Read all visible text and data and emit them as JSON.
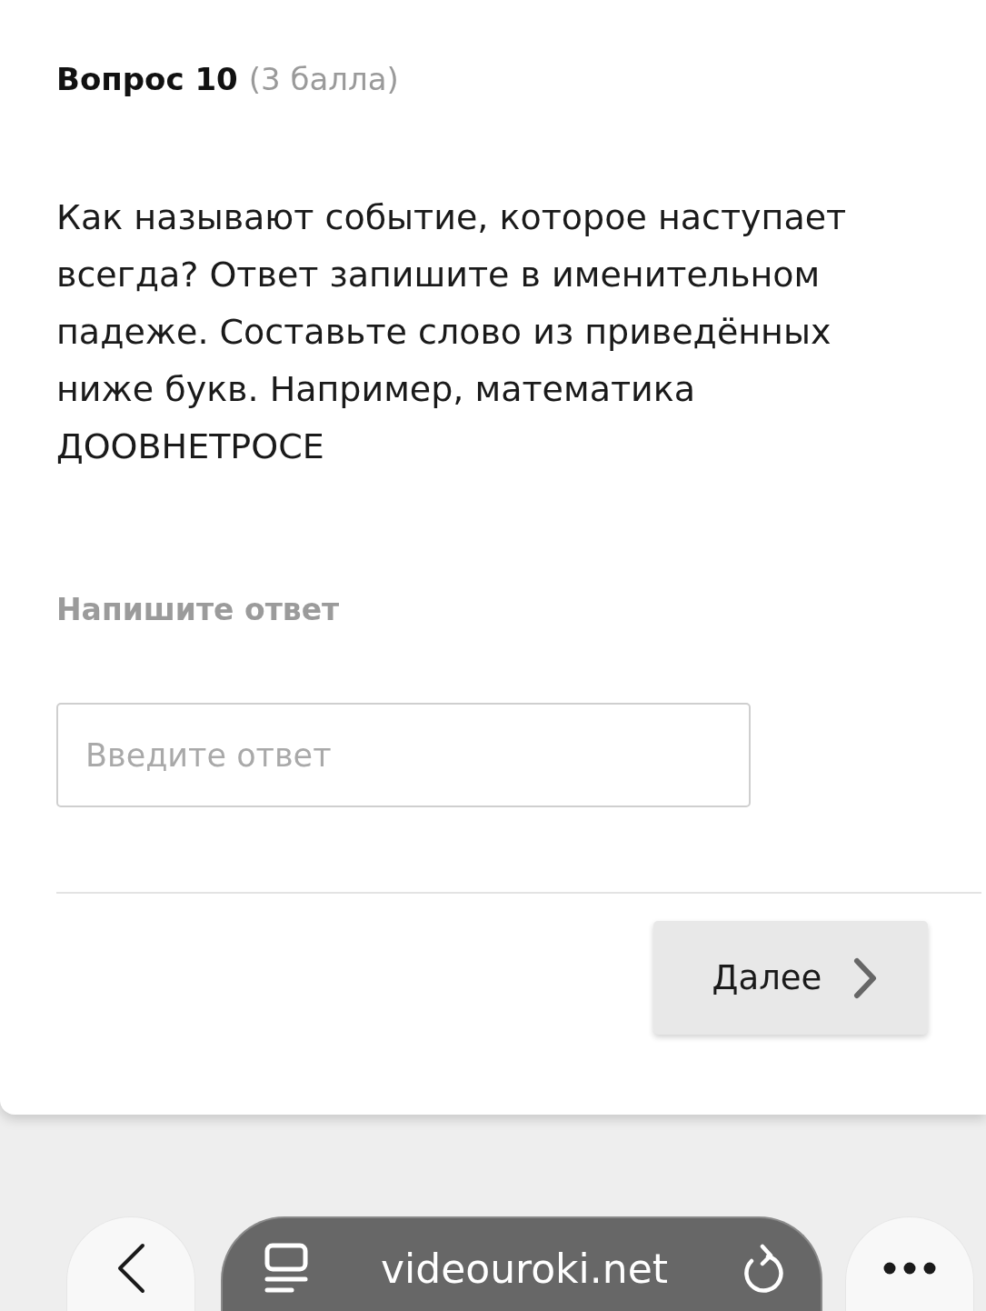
{
  "question": {
    "title": "Вопрос 10",
    "points": "(3 балла)",
    "text": "Как называют событие, которое наступает всегда? Ответ запишите в именительном падеже. Составьте слово из приведённых ниже букв. Например, математика",
    "letters": "ДООВНЕТРОСЕ"
  },
  "answer": {
    "label": "Напишите ответ",
    "placeholder": "Введите ответ"
  },
  "next_button": {
    "label": "Далее"
  },
  "browser_bar": {
    "url": "videouroki.net"
  }
}
